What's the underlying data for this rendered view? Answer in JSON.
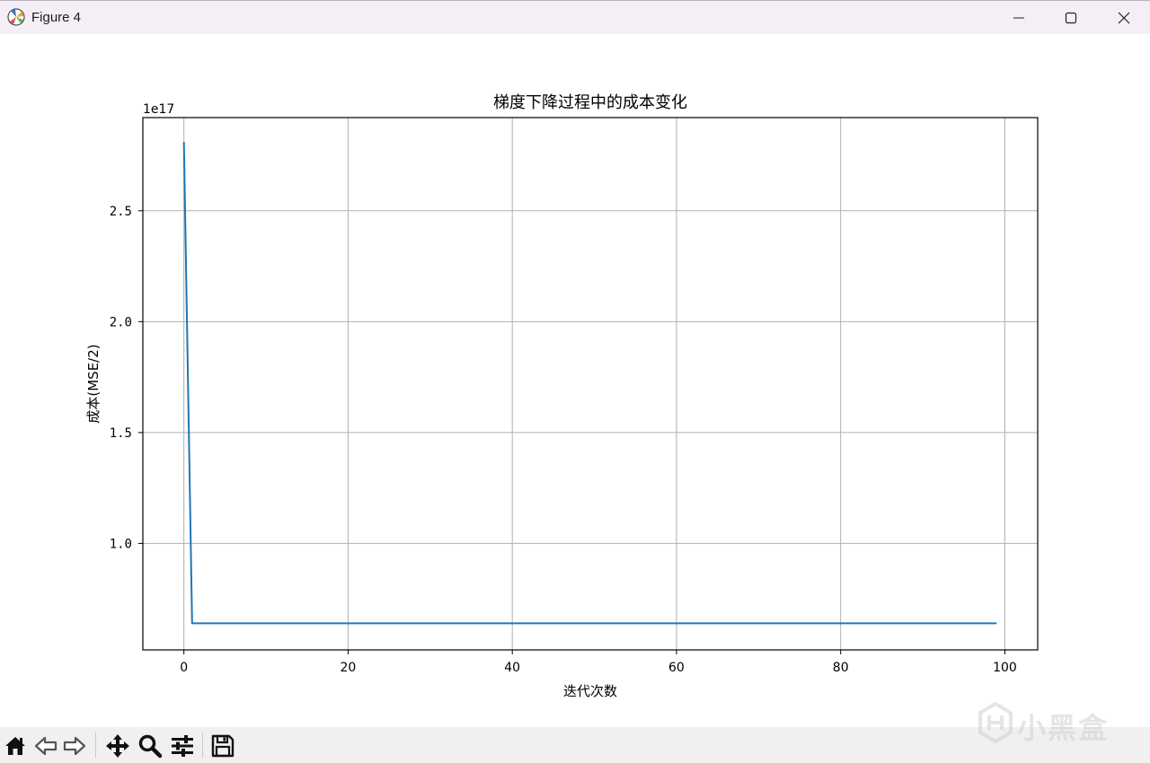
{
  "window": {
    "title": "Figure 4",
    "controls": {
      "minimize_icon": "minimize-icon",
      "maximize_icon": "maximize-icon",
      "close_icon": "close-icon"
    }
  },
  "toolbar": {
    "buttons": [
      {
        "name": "home",
        "icon": "home-icon"
      },
      {
        "name": "back",
        "icon": "back-arrow-icon"
      },
      {
        "name": "forward",
        "icon": "forward-arrow-icon"
      },
      {
        "name": "pan",
        "icon": "move-icon"
      },
      {
        "name": "zoom",
        "icon": "zoom-icon"
      },
      {
        "name": "configure-subplots",
        "icon": "sliders-icon"
      },
      {
        "name": "save",
        "icon": "save-icon"
      }
    ]
  },
  "watermark": {
    "text": "小黑盒"
  },
  "colors": {
    "line": "#1f77b4",
    "grid": "#b0b0b0",
    "axes": "#000000"
  },
  "chart_data": {
    "type": "line",
    "title": "梯度下降过程中的成本变化",
    "xlabel": "迭代次数",
    "ylabel": "成本(MSE/2)",
    "y_offset_label": "1e17",
    "grid": true,
    "xlim": [
      -5,
      104
    ],
    "ylim": [
      0.52,
      2.92
    ],
    "xticks": [
      0,
      20,
      40,
      60,
      80,
      100
    ],
    "yticks": [
      1.0,
      1.5,
      2.0,
      2.5
    ],
    "ytick_labels": [
      "1.0",
      "1.5",
      "2.0",
      "2.5"
    ],
    "series": [
      {
        "x": [
          0,
          1,
          2,
          3,
          4,
          5,
          6,
          7,
          8,
          9,
          10,
          11,
          12,
          13,
          14,
          15,
          16,
          17,
          18,
          19,
          20,
          21,
          22,
          23,
          24,
          25,
          26,
          27,
          28,
          29,
          30,
          31,
          32,
          33,
          34,
          35,
          36,
          37,
          38,
          39,
          40,
          41,
          42,
          43,
          44,
          45,
          46,
          47,
          48,
          49,
          50,
          51,
          52,
          53,
          54,
          55,
          56,
          57,
          58,
          59,
          60,
          61,
          62,
          63,
          64,
          65,
          66,
          67,
          68,
          69,
          70,
          71,
          72,
          73,
          74,
          75,
          76,
          77,
          78,
          79,
          80,
          81,
          82,
          83,
          84,
          85,
          86,
          87,
          88,
          89,
          90,
          91,
          92,
          93,
          94,
          95,
          96,
          97,
          98,
          99
        ],
        "values": [
          2.81,
          0.64,
          0.64,
          0.64,
          0.64,
          0.64,
          0.64,
          0.64,
          0.64,
          0.64,
          0.64,
          0.64,
          0.64,
          0.64,
          0.64,
          0.64,
          0.64,
          0.64,
          0.64,
          0.64,
          0.64,
          0.64,
          0.64,
          0.64,
          0.64,
          0.64,
          0.64,
          0.64,
          0.64,
          0.64,
          0.64,
          0.64,
          0.64,
          0.64,
          0.64,
          0.64,
          0.64,
          0.64,
          0.64,
          0.64,
          0.64,
          0.64,
          0.64,
          0.64,
          0.64,
          0.64,
          0.64,
          0.64,
          0.64,
          0.64,
          0.64,
          0.64,
          0.64,
          0.64,
          0.64,
          0.64,
          0.64,
          0.64,
          0.64,
          0.64,
          0.64,
          0.64,
          0.64,
          0.64,
          0.64,
          0.64,
          0.64,
          0.64,
          0.64,
          0.64,
          0.64,
          0.64,
          0.64,
          0.64,
          0.64,
          0.64,
          0.64,
          0.64,
          0.64,
          0.64,
          0.64,
          0.64,
          0.64,
          0.64,
          0.64,
          0.64,
          0.64,
          0.64,
          0.64,
          0.64,
          0.64,
          0.64,
          0.64,
          0.64,
          0.64,
          0.64,
          0.64,
          0.64,
          0.64,
          0.64
        ]
      }
    ]
  }
}
